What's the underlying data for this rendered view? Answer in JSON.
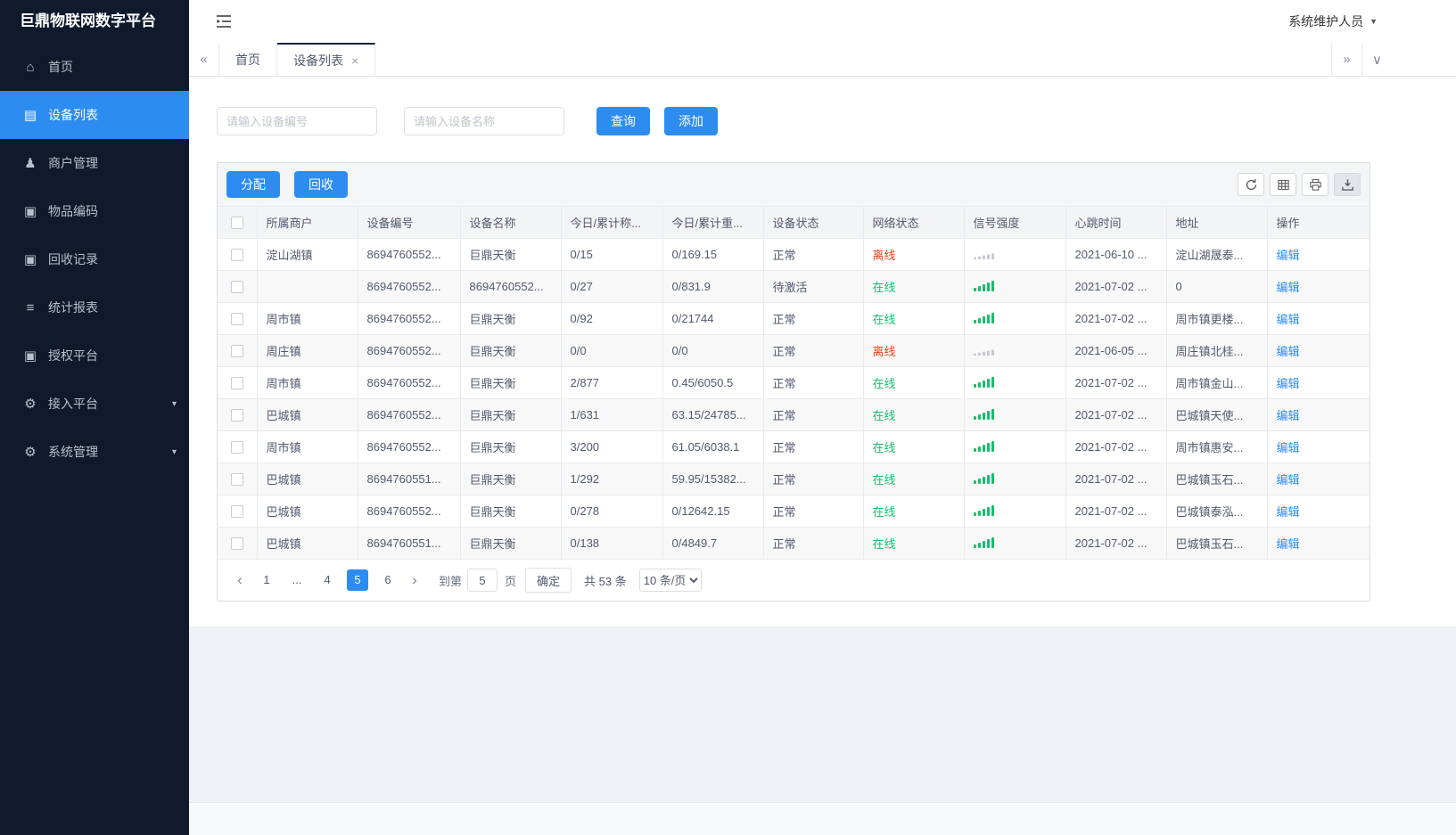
{
  "app": {
    "title": "巨鼎物联网数字平台",
    "user": "系统维护人员"
  },
  "colors": {
    "primary": "#2d8cf0",
    "success": "#19be6b",
    "danger": "#ed4014",
    "sidebar_bg": "#101a2c"
  },
  "sidebar": {
    "items": [
      {
        "id": "home",
        "label": "首页",
        "icon": "home-icon",
        "glyph": "home",
        "active": false,
        "expandable": false
      },
      {
        "id": "device-list",
        "label": "设备列表",
        "icon": "device-list-icon",
        "glyph": "list",
        "active": true,
        "expandable": false
      },
      {
        "id": "merchant-management",
        "label": "商户管理",
        "icon": "merchant-icon",
        "glyph": "user",
        "active": false,
        "expandable": false
      },
      {
        "id": "item-coding",
        "label": "物品编码",
        "icon": "item-code-icon",
        "glyph": "doc",
        "active": false,
        "expandable": false
      },
      {
        "id": "recycle-records",
        "label": "回收记录",
        "icon": "recycle-record-icon",
        "glyph": "doc",
        "active": false,
        "expandable": false
      },
      {
        "id": "statistics-reports",
        "label": "统计报表",
        "icon": "report-icon",
        "glyph": "menu",
        "active": false,
        "expandable": false
      },
      {
        "id": "authorization-platform",
        "label": "授权平台",
        "icon": "authorize-icon",
        "glyph": "doc",
        "active": false,
        "expandable": false
      },
      {
        "id": "access-platform",
        "label": "接入平台",
        "icon": "gear-icon",
        "glyph": "gear",
        "active": false,
        "expandable": true
      },
      {
        "id": "system-management",
        "label": "系统管理",
        "icon": "gear-icon",
        "glyph": "gear",
        "active": false,
        "expandable": true
      }
    ]
  },
  "tabs": {
    "items": [
      {
        "id": "home",
        "label": "首页",
        "active": false,
        "closable": false
      },
      {
        "id": "device-list",
        "label": "设备列表",
        "active": true,
        "closable": true
      }
    ]
  },
  "search": {
    "device_no_placeholder": "请输入设备编号",
    "device_name_placeholder": "请输入设备名称",
    "query_label": "查询",
    "add_label": "添加"
  },
  "toolbar": {
    "allocate_label": "分配",
    "recycle_label": "回收"
  },
  "table": {
    "headers": [
      "所属商户",
      "设备编号",
      "设备名称",
      "今日/累计称...",
      "今日/累计重...",
      "设备状态",
      "网络状态",
      "信号强度",
      "心跳时间",
      "地址",
      "操作"
    ],
    "edit_label": "编辑",
    "rows": [
      {
        "merchant": "淀山湖镇",
        "device_no": "8694760552...",
        "device_name": "巨鼎天衡",
        "today_count": "0/15",
        "today_weight": "0/169.15",
        "status": "正常",
        "network": "离线",
        "network_state": "offline",
        "signal": "weak",
        "heartbeat": "2021-06-10 ...",
        "address": "淀山湖晟泰..."
      },
      {
        "merchant": "",
        "device_no": "8694760552...",
        "device_name": "8694760552...",
        "today_count": "0/27",
        "today_weight": "0/831.9",
        "status": "待激活",
        "network": "在线",
        "network_state": "online",
        "signal": "strong",
        "heartbeat": "2021-07-02 ...",
        "address": "0"
      },
      {
        "merchant": "周市镇",
        "device_no": "8694760552...",
        "device_name": "巨鼎天衡",
        "today_count": "0/92",
        "today_weight": "0/21744",
        "status": "正常",
        "network": "在线",
        "network_state": "online",
        "signal": "strong",
        "heartbeat": "2021-07-02 ...",
        "address": "周市镇更楼..."
      },
      {
        "merchant": "周庄镇",
        "device_no": "8694760552...",
        "device_name": "巨鼎天衡",
        "today_count": "0/0",
        "today_weight": "0/0",
        "status": "正常",
        "network": "离线",
        "network_state": "offline",
        "signal": "weak",
        "heartbeat": "2021-06-05 ...",
        "address": "周庄镇北桂..."
      },
      {
        "merchant": "周市镇",
        "device_no": "8694760552...",
        "device_name": "巨鼎天衡",
        "today_count": "2/877",
        "today_weight": "0.45/6050.5",
        "status": "正常",
        "network": "在线",
        "network_state": "online",
        "signal": "strong",
        "heartbeat": "2021-07-02 ...",
        "address": "周市镇金山..."
      },
      {
        "merchant": "巴城镇",
        "device_no": "8694760552...",
        "device_name": "巨鼎天衡",
        "today_count": "1/631",
        "today_weight": "63.15/24785...",
        "status": "正常",
        "network": "在线",
        "network_state": "online",
        "signal": "strong",
        "heartbeat": "2021-07-02 ...",
        "address": "巴城镇天使..."
      },
      {
        "merchant": "周市镇",
        "device_no": "8694760552...",
        "device_name": "巨鼎天衡",
        "today_count": "3/200",
        "today_weight": "61.05/6038.1",
        "status": "正常",
        "network": "在线",
        "network_state": "online",
        "signal": "strong",
        "heartbeat": "2021-07-02 ...",
        "address": "周市镇惠安..."
      },
      {
        "merchant": "巴城镇",
        "device_no": "8694760551...",
        "device_name": "巨鼎天衡",
        "today_count": "1/292",
        "today_weight": "59.95/15382...",
        "status": "正常",
        "network": "在线",
        "network_state": "online",
        "signal": "strong",
        "heartbeat": "2021-07-02 ...",
        "address": "巴城镇玉石..."
      },
      {
        "merchant": "巴城镇",
        "device_no": "8694760552...",
        "device_name": "巨鼎天衡",
        "today_count": "0/278",
        "today_weight": "0/12642.15",
        "status": "正常",
        "network": "在线",
        "network_state": "online",
        "signal": "strong",
        "heartbeat": "2021-07-02 ...",
        "address": "巴城镇泰泓..."
      },
      {
        "merchant": "巴城镇",
        "device_no": "8694760551...",
        "device_name": "巨鼎天衡",
        "today_count": "0/138",
        "today_weight": "0/4849.7",
        "status": "正常",
        "network": "在线",
        "network_state": "online",
        "signal": "strong",
        "heartbeat": "2021-07-02 ...",
        "address": "巴城镇玉石..."
      }
    ]
  },
  "pagination": {
    "pages": [
      "1",
      "...",
      "4",
      "5",
      "6"
    ],
    "active_page": "5",
    "jump_prefix": "到第",
    "jump_value": "5",
    "jump_suffix": "页",
    "confirm_label": "确定",
    "total_text": "共 53 条",
    "page_size": "10 条/页"
  }
}
